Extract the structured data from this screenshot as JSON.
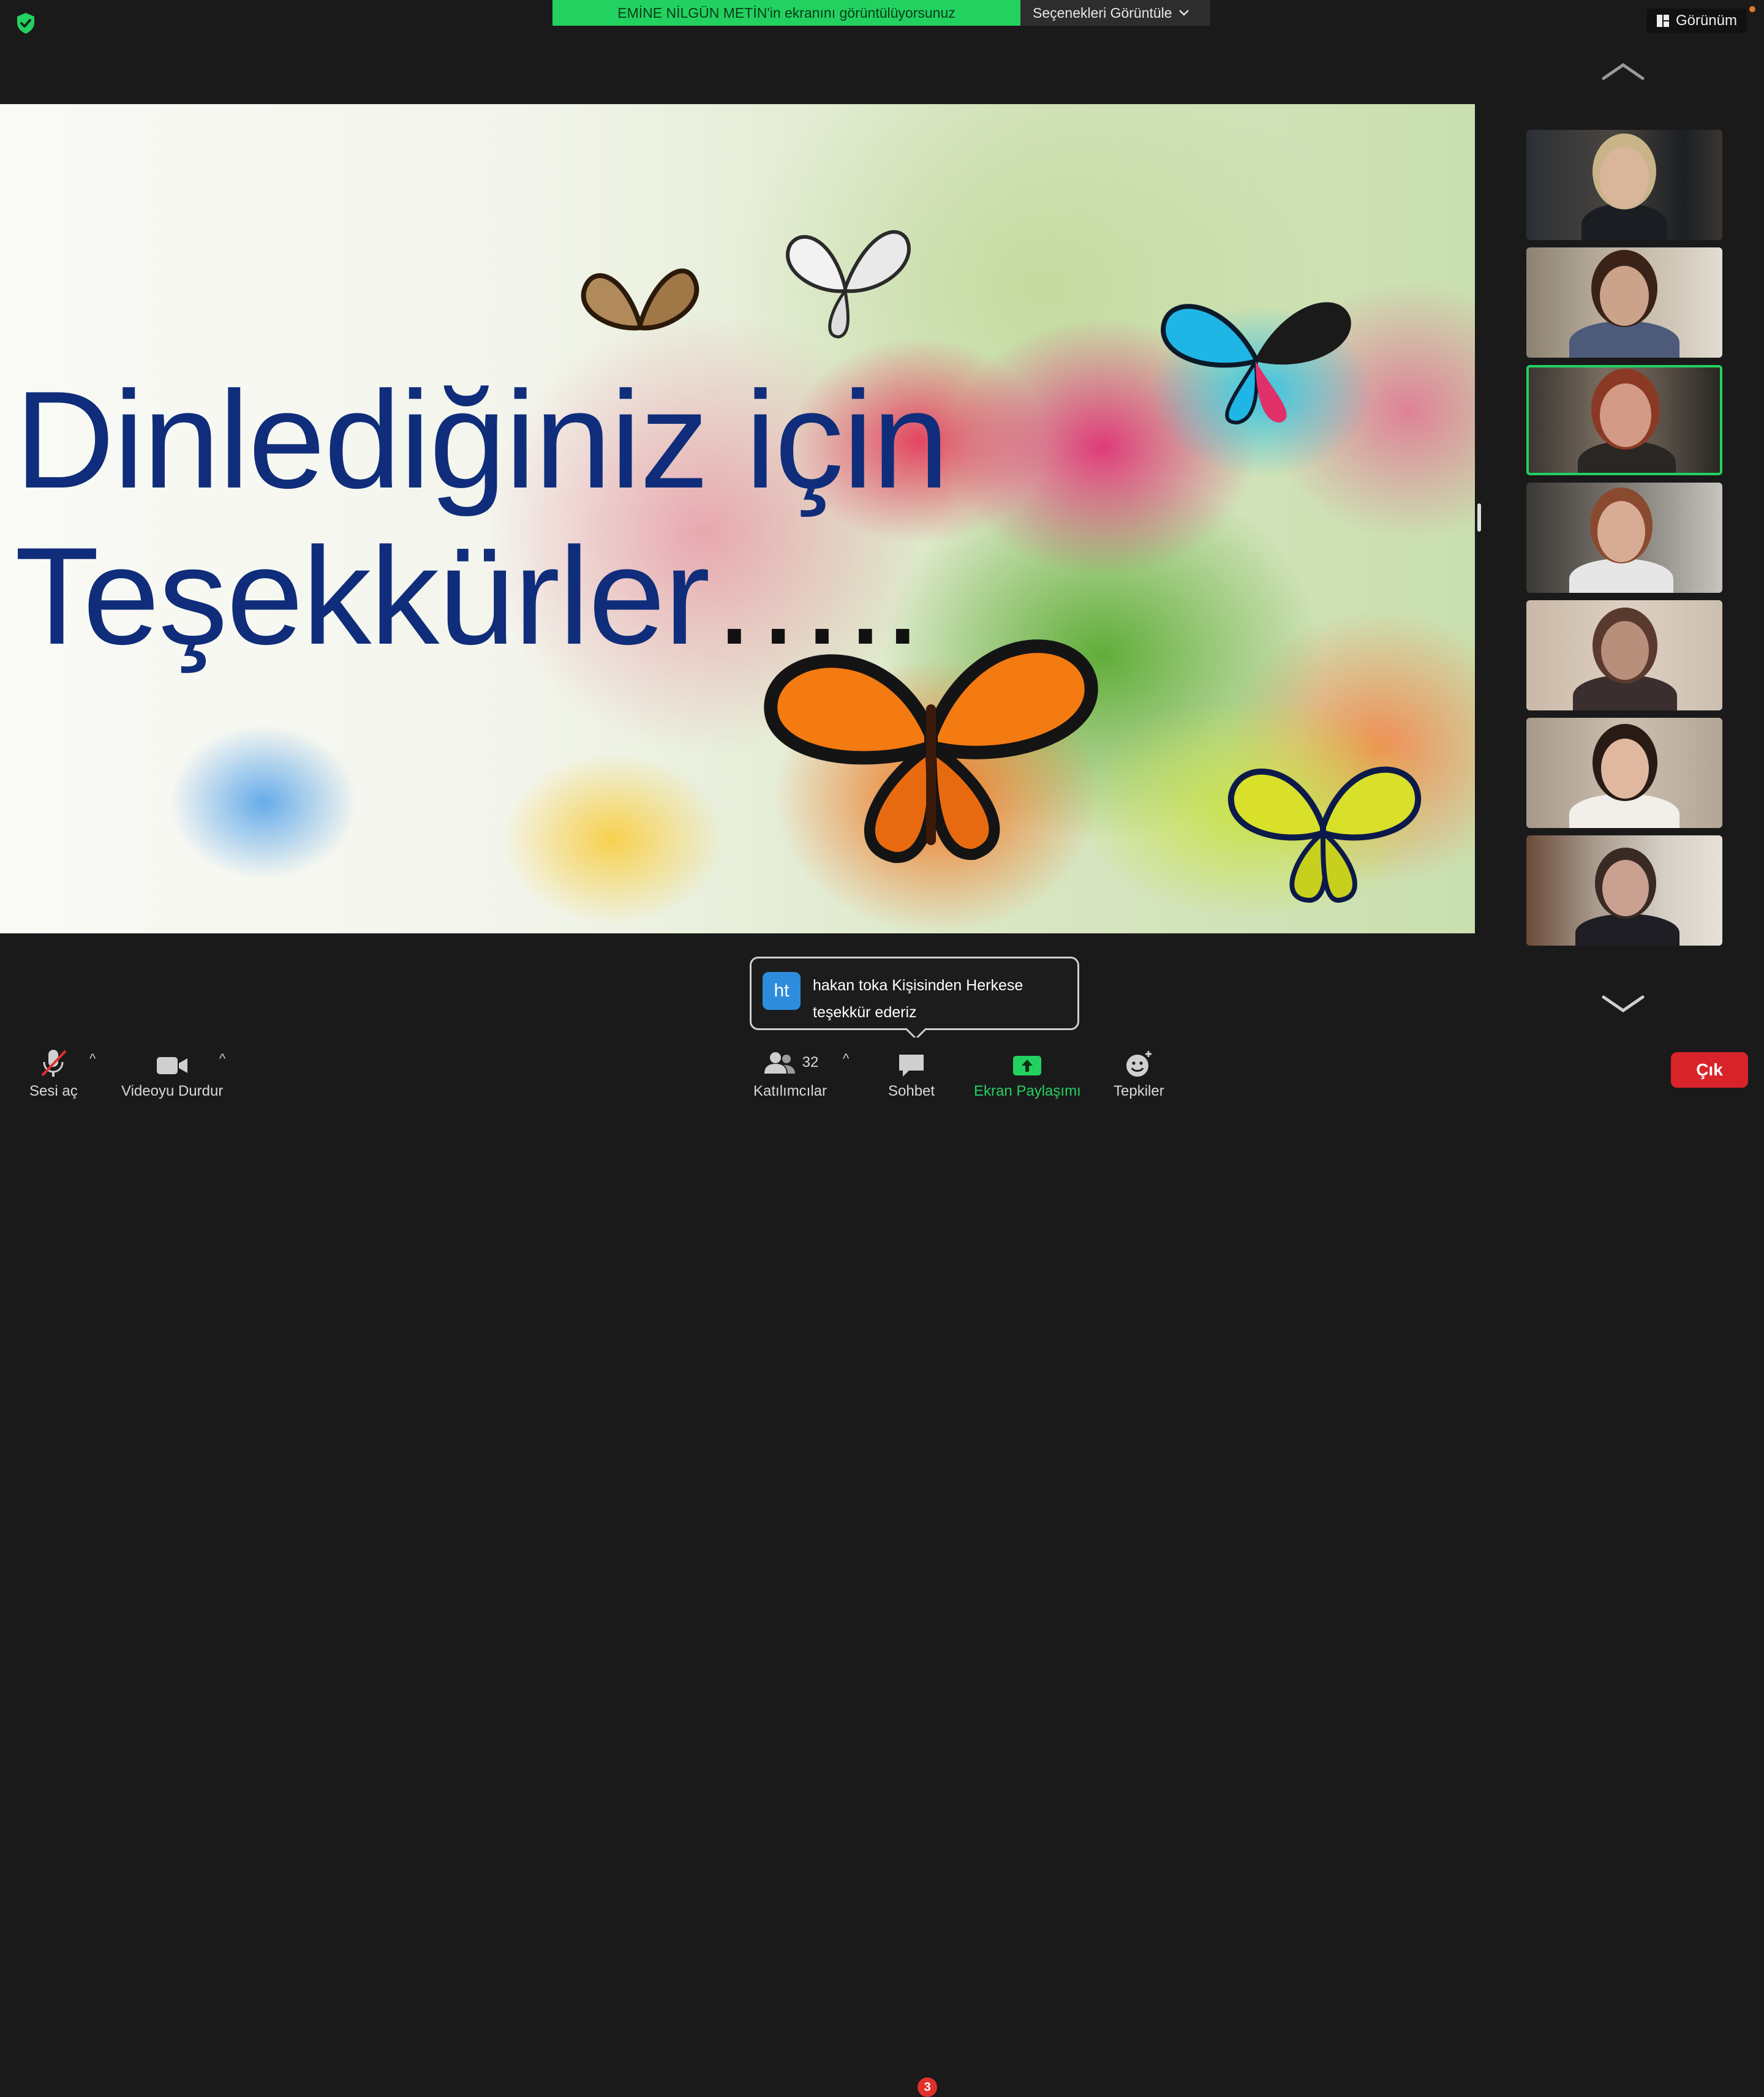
{
  "top_bar": {
    "share_banner_text": "EMİNE NİLGÜN METİN'in ekranını görüntülüyorsunuz",
    "view_options_label": "Seçenekleri Görüntüle",
    "view_button_label": "Görünüm"
  },
  "slide": {
    "title_line1": "Dinlediğiniz için",
    "title_line2": "Teşekkürler",
    "title_dots": "….."
  },
  "gallery": {
    "tile_count": 7,
    "active_speaker_tile": 3
  },
  "chat_toast": {
    "avatar_initials": "ht",
    "line1": "hakan toka Kişisinden Herkese",
    "line2": "teşekkür ederiz"
  },
  "toolbar": {
    "unmute_label": "Sesi aç",
    "video_label": "Videoyu Durdur",
    "participants_count": "32",
    "participants_label": "Katılımcılar",
    "chat_label": "Sohbet",
    "chat_badge": "3",
    "share_label": "Ekran Paylaşımı",
    "reactions_label": "Tepkiler",
    "leave_label": "Çık"
  },
  "colors": {
    "share_green": "#23d160",
    "leave_red": "#d9232a",
    "title_blue": "#0f2d7a",
    "toolbar_bg": "#1a1a1a"
  },
  "icons": [
    "shield-check-icon",
    "chevron-down-icon",
    "grid-view-icon",
    "chevron-up-icon",
    "muted-mic-icon",
    "video-camera-icon",
    "participants-icon",
    "chat-bubble-icon",
    "share-screen-icon",
    "reaction-emoji-icon"
  ]
}
